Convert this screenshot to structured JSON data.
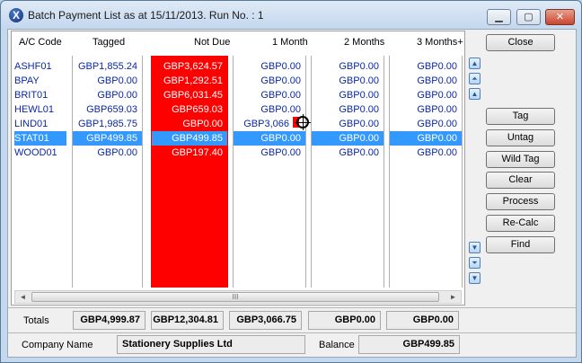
{
  "window": {
    "title": "Batch Payment List as at 15/11/2013. Run No. : 1",
    "app_icon": "X",
    "controls": {
      "minimize": "▁",
      "maximize": "▢",
      "close": "✕"
    }
  },
  "grid": {
    "headers": {
      "code": "A/C Code",
      "tagged": "Tagged",
      "notdue": "Not Due",
      "m1": "1 Month",
      "m2": "2 Months",
      "m3": "3 Months+"
    },
    "rows": [
      {
        "code": "ASHF01",
        "tagged": "GBP1,855.24",
        "notdue": "GBP3,624.57",
        "m1": "GBP0.00",
        "m2": "GBP0.00",
        "m3": "GBP0.00"
      },
      {
        "code": "BPAY",
        "tagged": "GBP0.00",
        "notdue": "GBP1,292.51",
        "m1": "GBP0.00",
        "m2": "GBP0.00",
        "m3": "GBP0.00"
      },
      {
        "code": "BRIT01",
        "tagged": "GBP0.00",
        "notdue": "GBP6,031.45",
        "m1": "GBP0.00",
        "m2": "GBP0.00",
        "m3": "GBP0.00"
      },
      {
        "code": "HEWL01",
        "tagged": "GBP659.03",
        "notdue": "GBP659.03",
        "m1": "GBP0.00",
        "m2": "GBP0.00",
        "m3": "GBP0.00"
      },
      {
        "code": "LIND01",
        "tagged": "GBP1,985.75",
        "notdue": "GBP0.00",
        "m1": "GBP3,066",
        "m2": "GBP0.00",
        "m3": "GBP0.00"
      },
      {
        "code": "STAT01",
        "tagged": "GBP499.85",
        "notdue": "GBP499.85",
        "m1": "GBP0.00",
        "m2": "GBP0.00",
        "m3": "GBP0.00"
      },
      {
        "code": "WOOD01",
        "tagged": "GBP0.00",
        "notdue": "GBP197.40",
        "m1": "GBP0.00",
        "m2": "GBP0.00",
        "m3": "GBP0.00"
      }
    ],
    "selected_row": "STAT01",
    "scrollbar": {
      "left": "◄",
      "right": "►",
      "grip": "III"
    }
  },
  "nav_buttons": {
    "up": "▲",
    "page_up": "⏶",
    "up_small": "▲",
    "down": "▼",
    "page_down": "⏷",
    "down_small": "▼"
  },
  "buttons": {
    "close": "Close",
    "tag": "Tag",
    "untag": "Untag",
    "wild_tag": "Wild Tag",
    "clear": "Clear",
    "process": "Process",
    "recalc": "Re-Calc",
    "find": "Find"
  },
  "totals": {
    "label": "Totals",
    "tagged": "GBP4,999.87",
    "notdue": "GBP12,304.81",
    "m1": "GBP3,066.75",
    "m2": "GBP0.00",
    "m3": "GBP0.00"
  },
  "footer": {
    "company_label": "Company Name",
    "company_value": "Stationery Supplies Ltd",
    "balance_label": "Balance",
    "balance_value": "GBP499.85"
  },
  "colors": {
    "notdue_bg": "#ff0000",
    "selection": "#3399ff",
    "value_text": "#0b27a8"
  }
}
